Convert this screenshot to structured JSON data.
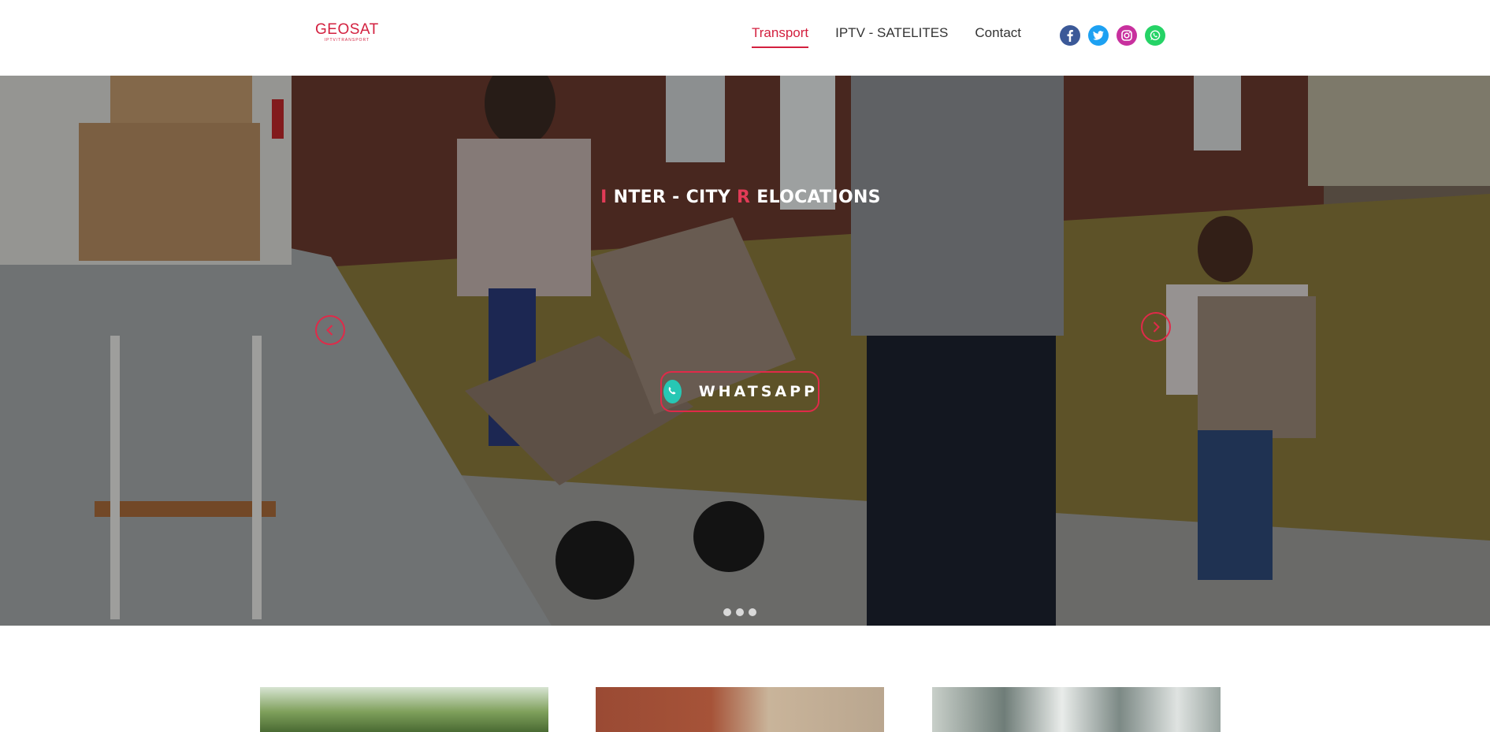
{
  "header": {
    "logo_main": "GEOSAT",
    "logo_sub": "IPTV/TRANSPORT",
    "nav": [
      {
        "label": "Transport",
        "active": true
      },
      {
        "label": "IPTV - SATELITES",
        "active": false
      },
      {
        "label": "Contact",
        "active": false
      }
    ],
    "social": [
      "facebook-icon",
      "twitter-icon",
      "instagram-icon",
      "whatsapp-icon"
    ]
  },
  "hero": {
    "title_parts": {
      "first_letter_1": "I",
      "rest_1": "NTER - CITY ",
      "first_letter_2": "R",
      "rest_2": "ELOCATIONS"
    },
    "button_label": "WHATSAPP",
    "slide_count": 3
  },
  "colors": {
    "accent": "#d3203f",
    "whatsapp_button_icon": "#27c7b4"
  }
}
